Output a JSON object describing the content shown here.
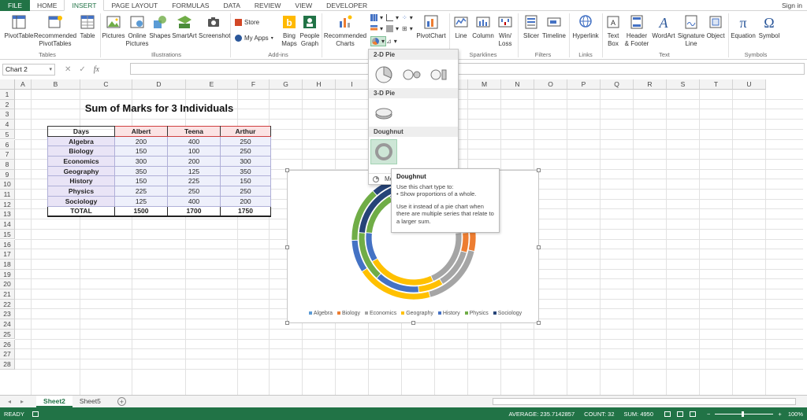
{
  "tabs": [
    "FILE",
    "HOME",
    "INSERT",
    "PAGE LAYOUT",
    "FORMULAS",
    "DATA",
    "REVIEW",
    "VIEW",
    "DEVELOPER"
  ],
  "active_tab": "INSERT",
  "signin": "Sign in",
  "ribbon": {
    "pivottable": "PivotTable",
    "rec_pivot_1": "Recommended",
    "rec_pivot_2": "PivotTables",
    "table": "Table",
    "tables_group": "Tables",
    "pictures": "Pictures",
    "online_1": "Online",
    "online_2": "Pictures",
    "shapes": "Shapes",
    "smartart": "SmartArt",
    "screenshot": "Screenshot",
    "illustrations_group": "Illustrations",
    "store": "Store",
    "myapps": "My Apps",
    "bing_1": "Bing",
    "bing_2": "Maps",
    "people_1": "People",
    "people_2": "Graph",
    "addins_group": "Add-ins",
    "rec_charts_1": "Recommended",
    "rec_charts_2": "Charts",
    "pivotchart": "PivotChart",
    "line": "Line",
    "column": "Column",
    "winloss_1": "Win/",
    "winloss_2": "Loss",
    "sparklines_group": "Sparklines",
    "slicer": "Slicer",
    "timeline": "Timeline",
    "filters_group": "Filters",
    "hyperlink": "Hyperlink",
    "links_group": "Links",
    "textbox_1": "Text",
    "textbox_2": "Box",
    "header_1": "Header",
    "header_2": "& Footer",
    "wordart": "WordArt",
    "signature_1": "Signature",
    "signature_2": "Line",
    "object": "Object",
    "text_group": "Text",
    "equation": "Equation",
    "symbol": "Symbol",
    "symbols_group": "Symbols"
  },
  "namebox": "Chart 2",
  "columns": [
    "A",
    "B",
    "C",
    "D",
    "E",
    "F",
    "G",
    "H",
    "I",
    "J",
    "K",
    "L",
    "M",
    "N",
    "O",
    "P",
    "Q",
    "R",
    "S",
    "T",
    "U"
  ],
  "rows": [
    "1",
    "2",
    "3",
    "4",
    "5",
    "6",
    "7",
    "8",
    "9",
    "10",
    "11",
    "12",
    "13",
    "14",
    "15",
    "16",
    "17",
    "18",
    "19",
    "20",
    "21",
    "22",
    "23",
    "24",
    "25",
    "26",
    "27",
    "28"
  ],
  "sheet": {
    "title": "Sum of Marks for 3 Individuals",
    "headers": [
      "Days",
      "Albert",
      "Teena",
      "Arthur"
    ],
    "rows": [
      [
        "Algebra",
        "200",
        "400",
        "250"
      ],
      [
        "Biology",
        "150",
        "100",
        "250"
      ],
      [
        "Economics",
        "300",
        "200",
        "300"
      ],
      [
        "Geography",
        "350",
        "125",
        "350"
      ],
      [
        "History",
        "150",
        "225",
        "150"
      ],
      [
        "Physics",
        "225",
        "250",
        "250"
      ],
      [
        "Sociology",
        "125",
        "400",
        "200"
      ]
    ],
    "total": [
      "TOTAL",
      "1500",
      "1700",
      "1750"
    ]
  },
  "chart_data": {
    "type": "doughnut",
    "categories": [
      "Algebra",
      "Biology",
      "Economics",
      "Geography",
      "History",
      "Physics",
      "Sociology"
    ],
    "series": [
      {
        "values": [
          200,
          150,
          300,
          350,
          150,
          225,
          125
        ]
      },
      {
        "values": [
          400,
          100,
          200,
          125,
          225,
          250,
          400
        ]
      },
      {
        "values": [
          250,
          250,
          300,
          350,
          150,
          250,
          200
        ]
      }
    ],
    "colors": [
      "#5b9bd5",
      "#ed7d31",
      "#a5a5a5",
      "#ffc000",
      "#4472c4",
      "#70ad47",
      "#264478"
    ],
    "legend": "bottom"
  },
  "dropdown": {
    "section_2d": "2-D Pie",
    "section_3d": "3-D Pie",
    "section_doughnut": "Doughnut",
    "more": "Mo"
  },
  "tooltip": {
    "title": "Doughnut",
    "line1": "Use this chart type to:",
    "line2": "• Show proportions of a whole.",
    "line3": "Use it instead of a pie chart when there are multiple series that relate to a larger sum."
  },
  "sheet_tabs": [
    "Sheet2",
    "Sheet5"
  ],
  "status": {
    "ready": "READY",
    "average": "AVERAGE: 235.7142857",
    "count": "COUNT: 32",
    "sum": "SUM: 4950",
    "zoom": "100%"
  }
}
